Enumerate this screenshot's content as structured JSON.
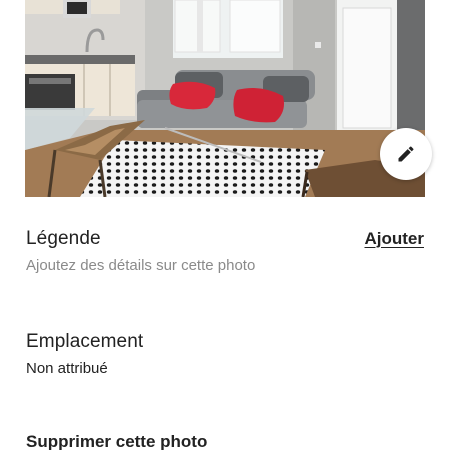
{
  "photo": {
    "alt": "Photo de l'appartement"
  },
  "edit": {
    "icon": "pencil-icon"
  },
  "caption": {
    "title": "Légende",
    "action": "Ajouter",
    "placeholder": "Ajoutez des détails sur cette photo"
  },
  "location": {
    "title": "Emplacement",
    "value": "Non attribué"
  },
  "delete": {
    "label": "Supprimer cette photo"
  },
  "colors": {
    "text": "#222222",
    "muted": "#8a8a8a"
  }
}
